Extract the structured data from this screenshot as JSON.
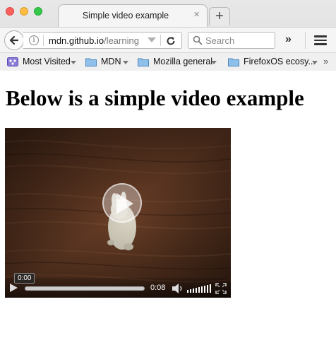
{
  "window": {
    "tab_title": "Simple video example",
    "tab_close": "×",
    "new_tab": "+"
  },
  "navbar": {
    "url_host": "mdn.github.io",
    "url_path": "/learning",
    "info_glyph": "i",
    "search_placeholder": "Search",
    "overflow": "»"
  },
  "bookmarks": [
    {
      "label": "Most Visited",
      "icon": "most-visited-icon"
    },
    {
      "label": "MDN",
      "icon": "folder-icon"
    },
    {
      "label": "Mozilla general",
      "icon": "folder-icon"
    },
    {
      "label": "FirefoxOS ecosy...",
      "icon": "folder-icon"
    }
  ],
  "bookmarks_overflow": "»",
  "page": {
    "heading": "Below is a simple video example"
  },
  "video": {
    "current_time": "0:00",
    "duration": "0:08",
    "progress": 0,
    "volume_level": 1.0
  },
  "colors": {
    "close": "#fc605c",
    "minimize": "#fdbc40",
    "maximize": "#34c84a",
    "folder": "#6fa8dc"
  }
}
